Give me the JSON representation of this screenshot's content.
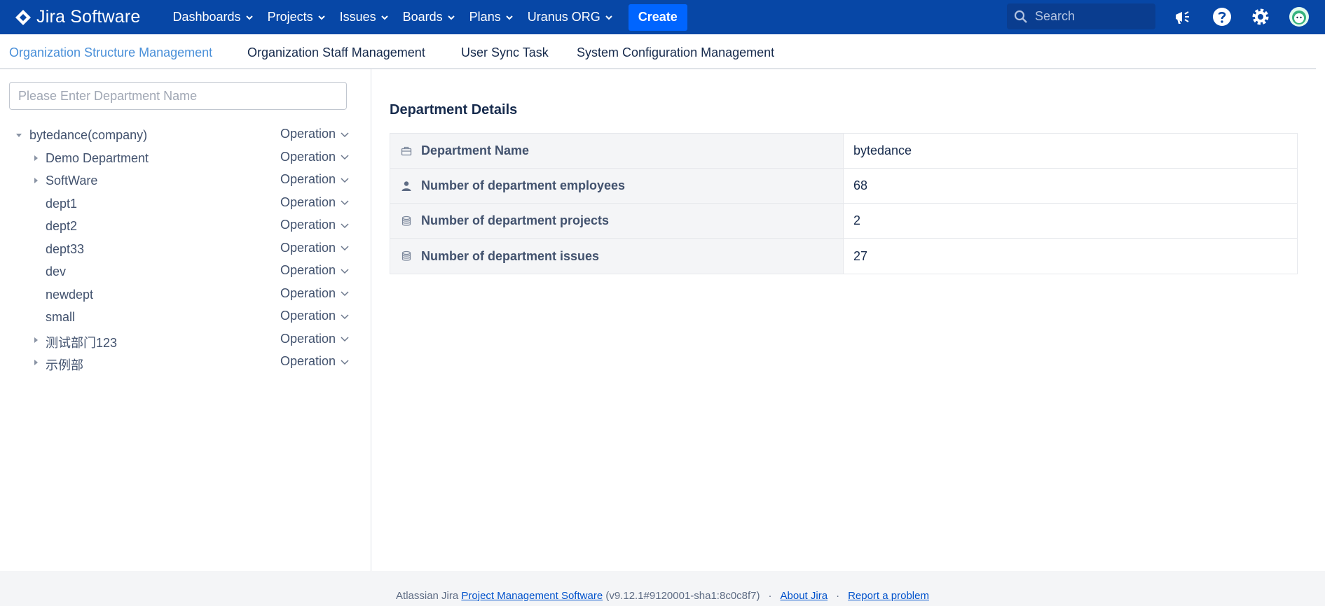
{
  "app": {
    "name": "Jira Software"
  },
  "nav": {
    "items": [
      {
        "label": "Dashboards"
      },
      {
        "label": "Projects"
      },
      {
        "label": "Issues"
      },
      {
        "label": "Boards"
      },
      {
        "label": "Plans"
      },
      {
        "label": "Uranus ORG"
      }
    ],
    "create_label": "Create",
    "search_placeholder": "Search",
    "icons": [
      "notifications-icon",
      "help-icon",
      "settings-icon",
      "avatar"
    ]
  },
  "tabs": [
    {
      "label": "Organization Structure Management",
      "active": true
    },
    {
      "label": "Organization Staff Management",
      "active": false
    },
    {
      "label": "User Sync Task",
      "active": false
    },
    {
      "label": "System Configuration Management",
      "active": false
    }
  ],
  "tree": {
    "search_placeholder": "Please Enter Department Name",
    "operation_label": "Operation",
    "nodes": [
      {
        "label": "bytedance(company)",
        "level": 0,
        "caret": "expanded"
      },
      {
        "label": "Demo Department",
        "level": 1,
        "caret": "collapsed"
      },
      {
        "label": "SoftWare",
        "level": 1,
        "caret": "collapsed"
      },
      {
        "label": "dept1",
        "level": 1,
        "caret": "none"
      },
      {
        "label": "dept2",
        "level": 1,
        "caret": "none"
      },
      {
        "label": "dept33",
        "level": 1,
        "caret": "none"
      },
      {
        "label": "dev",
        "level": 1,
        "caret": "none"
      },
      {
        "label": "newdept",
        "level": 1,
        "caret": "none"
      },
      {
        "label": "small",
        "level": 1,
        "caret": "none"
      },
      {
        "label": "测试部门123",
        "level": 1,
        "caret": "collapsed"
      },
      {
        "label": "示例部",
        "level": 1,
        "caret": "collapsed"
      }
    ]
  },
  "details": {
    "title": "Department Details",
    "rows": [
      {
        "icon": "briefcase-icon",
        "label": "Department Name",
        "value": "bytedance"
      },
      {
        "icon": "person-icon",
        "label": "Number of department employees",
        "value": "68"
      },
      {
        "icon": "database-icon",
        "label": "Number of department projects",
        "value": "2"
      },
      {
        "icon": "database-icon",
        "label": "Number of department issues",
        "value": "27"
      }
    ]
  },
  "footer": {
    "prefix": "Atlassian Jira",
    "pm_link": "Project Management Software",
    "version": "(v9.12.1#9120001-sha1:8c0c8f7)",
    "about_link": "About Jira",
    "report_link": "Report a problem",
    "separator": "·"
  },
  "colors": {
    "topbar": "#0747a6",
    "create": "#0065ff",
    "active_tab": "#4a90d9"
  }
}
